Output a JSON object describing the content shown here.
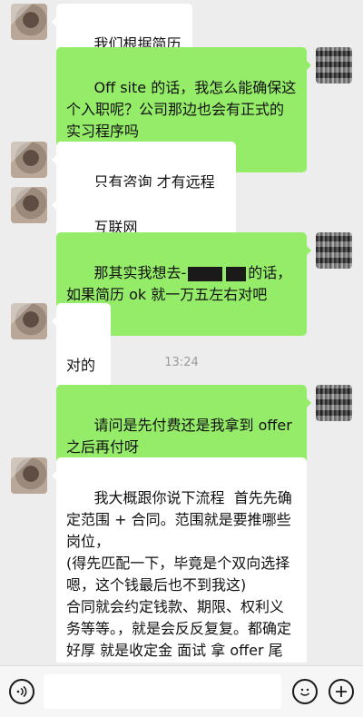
{
  "messages": [
    {
      "side": "left",
      "text": "我们根据简历细聊"
    },
    {
      "side": "right",
      "text": "Off site 的话，我怎么能确保这个入职呢？公司那边也会有正式的实习程序吗"
    },
    {
      "side": "left",
      "text": "只有咨询 才有远程正式"
    },
    {
      "side": "left",
      "text": "互联网没有"
    },
    {
      "side": "right",
      "text_before": "那其实我想去-",
      "text_after": "的话，\n如果简历 ok 就一万五左右对吧"
    },
    {
      "side": "left",
      "text": "对的"
    },
    {
      "side": "right",
      "text": "请问是先付费还是我拿到 offer 之后再付呀"
    },
    {
      "side": "left",
      "text": "我大概跟你说下流程  首先先确定范围 + 合同。范围就是要推哪些岗位，\n(得先匹配一下，毕竟是个双向选择 嗯，这个钱最后也不到我这)\n合同就会约定钱款、期限、权利义务等等。，就是会反反复复。都确定好厚 就是收定金 面试 拿 offer 尾款。"
    }
  ],
  "timestamp": "13:24",
  "bottom_bar": {
    "voice_icon": "voice-icon",
    "emoji_icon": "emoji-icon",
    "plus_icon": "plus-icon"
  },
  "colors": {
    "background": "#ededed",
    "self_bubble": "#95ec69",
    "peer_bubble": "#ffffff"
  }
}
